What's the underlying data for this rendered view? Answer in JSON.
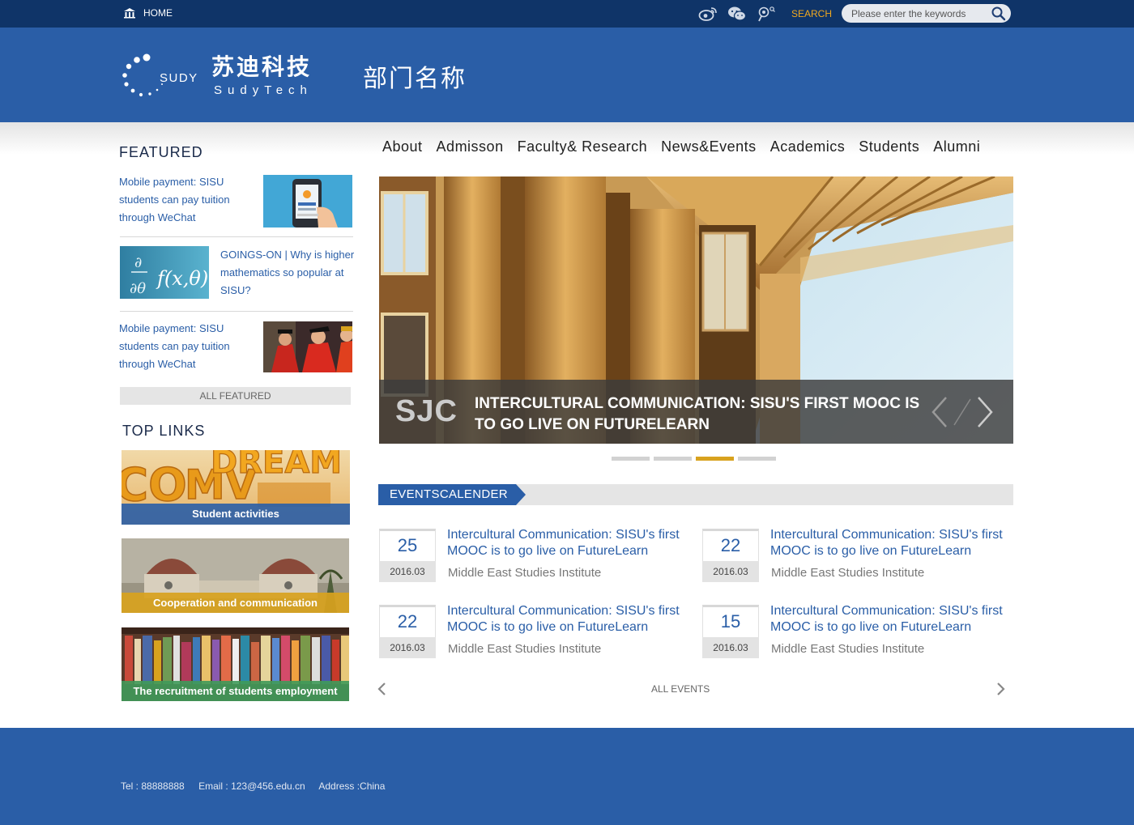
{
  "topbar": {
    "home_label": "HOME",
    "social_icons": [
      "weibo-icon",
      "wechat-icon",
      "person-search-icon"
    ],
    "search_label": "SEARCH",
    "search_placeholder": "Please enter the keywords"
  },
  "header": {
    "logo_brand_cn": "苏迪科技",
    "logo_brand_en": "SudyTech",
    "logo_mark": "SUDY",
    "department": "部门名称"
  },
  "nav": {
    "items": [
      "About",
      "Admisson",
      "Faculty& Research",
      "News&Events",
      "Academics",
      "Students",
      "Alumni"
    ]
  },
  "featured": {
    "title": "FEATURED",
    "items": [
      {
        "text": "Mobile payment: SISU students can pay tuition through WeChat"
      },
      {
        "text": "GOINGS-ON | Why is higher mathematics so popular at SISU?"
      },
      {
        "text": "Mobile payment: SISU students can pay tuition through WeChat"
      }
    ],
    "all_label": "ALL FEATURED"
  },
  "top_links": {
    "title": "TOP LINKS",
    "items": [
      {
        "caption": "Student activities",
        "color": "#2a5ea7"
      },
      {
        "caption": "Cooperation and communication",
        "color": "#d8a21e"
      },
      {
        "caption": "The recruitment of students employment",
        "color": "#3f9a5a"
      }
    ]
  },
  "slider": {
    "badge": "SJC",
    "title": "INTERCULTURAL COMMUNICATION: SISU'S FIRST MOOC IS TO GO LIVE ON FUTURELEARN",
    "slide_count": 4,
    "active_slide": 3
  },
  "events": {
    "title": "EVENTSCALENDER",
    "items": [
      {
        "day": "25",
        "ym": "2016.03",
        "title": "Intercultural Communication: SISU's first MOOC is to go live on FutureLearn",
        "org": "Middle East Studies Institute"
      },
      {
        "day": "22",
        "ym": "2016.03",
        "title": "Intercultural Communication: SISU's first MOOC is to go live on FutureLearn",
        "org": "Middle East Studies Institute"
      },
      {
        "day": "22",
        "ym": "2016.03",
        "title": "Intercultural Communication: SISU's first MOOC is to go live on FutureLearn",
        "org": "Middle East Studies Institute"
      },
      {
        "day": "15",
        "ym": "2016.03",
        "title": "Intercultural Communication: SISU's first MOOC is to go live on FutureLearn",
        "org": "Middle East Studies Institute"
      }
    ],
    "all_label": "ALL EVENTS"
  },
  "footer": {
    "tel": "Tel : 88888888",
    "email": "Email : 123@456.edu.cn",
    "address": "Address :China"
  },
  "colors": {
    "brand_blue": "#2a5ea7",
    "topbar_navy": "#0f3468",
    "accent_gold": "#d8a21e",
    "search_orange": "#f0a81f"
  }
}
